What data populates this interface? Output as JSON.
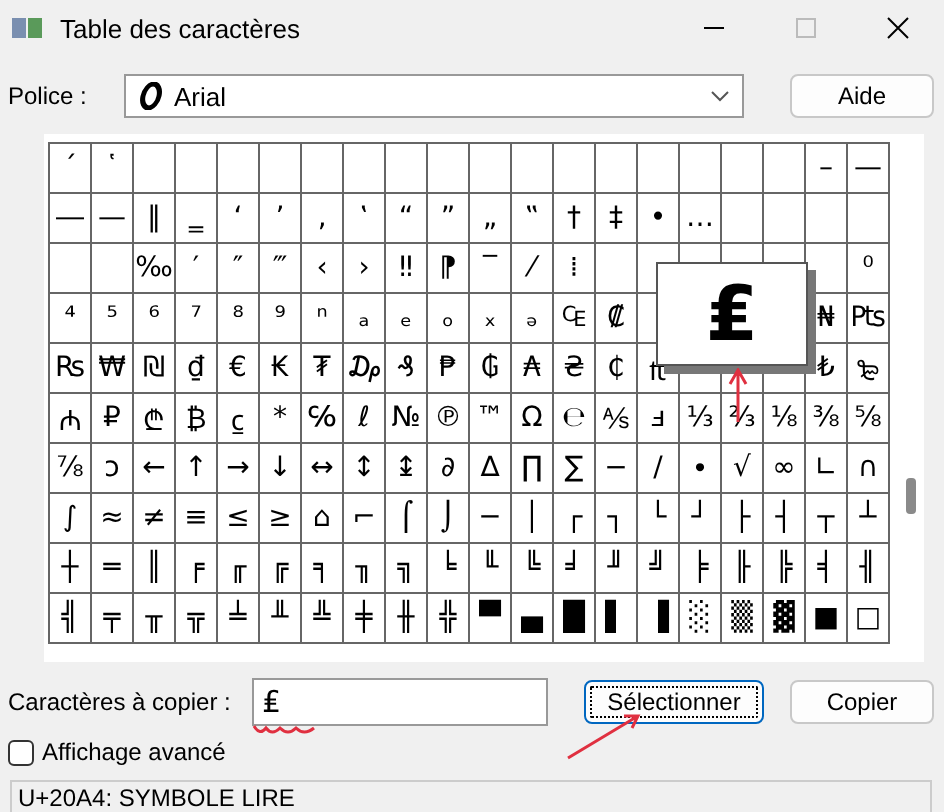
{
  "window": {
    "title": "Table des caractères"
  },
  "font": {
    "label": "Police :",
    "value": "Arial"
  },
  "help_button": "Aide",
  "grid": {
    "rows": [
      [
        "´",
        "῾",
        null,
        null,
        null,
        null,
        null,
        null,
        null,
        null,
        null,
        null,
        null,
        null,
        null,
        null,
        null,
        null,
        "–",
        "—"
      ],
      [
        "―",
        "—",
        "‖",
        "‗",
        "‘",
        "’",
        "‚",
        "‛",
        "“",
        "”",
        "„",
        "‟",
        "†",
        "‡",
        "•",
        "…",
        null,
        null,
        null,
        null
      ],
      [
        null,
        null,
        "‰",
        "′",
        "″",
        "‴",
        "‹",
        "›",
        "‼",
        "⁋",
        "‾",
        "⁄",
        "⁞",
        null,
        null,
        null,
        null,
        null,
        null,
        "⁰"
      ],
      [
        "⁴",
        "⁵",
        "⁶",
        "⁷",
        "⁸",
        "⁹",
        "ⁿ",
        "ₐ",
        "ₑ",
        "ₒ",
        "ₓ",
        "ₔ",
        "₠",
        "₡",
        null,
        null,
        null,
        null,
        "₦",
        "₧"
      ],
      [
        "₨",
        "₩",
        "₪",
        "₫",
        "€",
        "₭",
        "₮",
        "₯",
        "₰",
        "₱",
        "₲",
        "₳",
        "₴",
        "₵",
        "₶",
        null,
        null,
        null,
        "₺",
        "₻"
      ],
      [
        "₼",
        "₽",
        "₾",
        "₿",
        "⃀",
        "*",
        "℅",
        "ℓ",
        "№",
        "℗",
        "™",
        "Ω",
        "℮",
        "⅍",
        "ⅎ",
        "⅓",
        "⅔",
        "⅛",
        "⅜",
        "⅝"
      ],
      [
        "⅞",
        "ↄ",
        "←",
        "↑",
        "→",
        "↓",
        "↔",
        "↕",
        "↨",
        "∂",
        "∆",
        "∏",
        "∑",
        "−",
        "∕",
        "∙",
        "√",
        "∞",
        "∟",
        "∩"
      ],
      [
        "∫",
        "≈",
        "≠",
        "≡",
        "≤",
        "≥",
        "⌂",
        "⌐",
        "⌠",
        "⌡",
        "─",
        "│",
        "┌",
        "┐",
        "└",
        "┘",
        "├",
        "┤",
        "┬",
        "┴"
      ],
      [
        "┼",
        "═",
        "║",
        "╒",
        "╓",
        "╔",
        "╕",
        "╖",
        "╗",
        "╘",
        "╙",
        "╚",
        "╛",
        "╜",
        "╝",
        "╞",
        "╟",
        "╠",
        "╡",
        "╢"
      ],
      [
        "╣",
        "╤",
        "╥",
        "╦",
        "╧",
        "╨",
        "╩",
        "╪",
        "╫",
        "╬",
        "▀",
        "▄",
        "█",
        "▌",
        "▐",
        "░",
        "▒",
        "▓",
        "■",
        "□"
      ]
    ],
    "magnified": "₤"
  },
  "copy": {
    "label": "Caractères à copier :",
    "value": "₤"
  },
  "buttons": [
    {
      "label": "Sélectionner",
      "focused": true
    },
    {
      "label": "Copier",
      "focused": false
    }
  ],
  "advanced": {
    "label": "Affichage avancé",
    "checked": false
  },
  "status_bar": "U+20A4: SYMBOLE LIRE"
}
